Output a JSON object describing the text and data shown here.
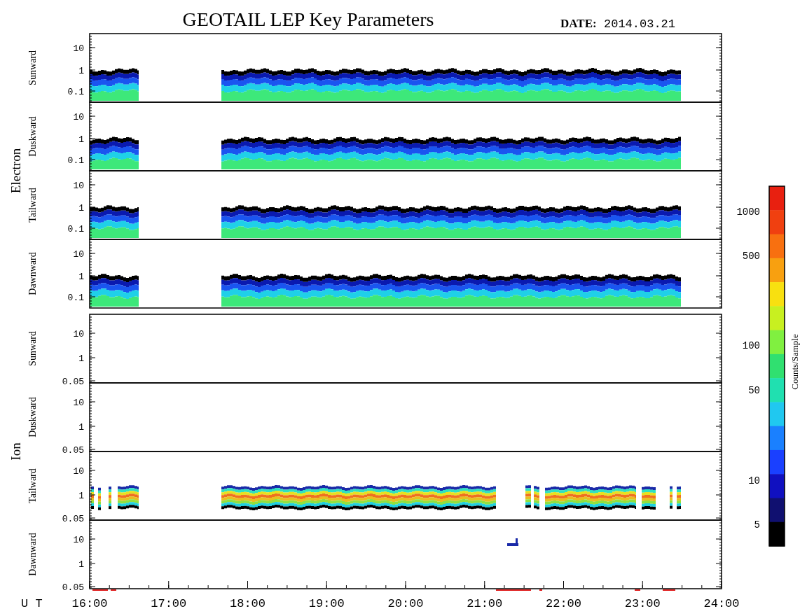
{
  "title": "GEOTAIL LEP Key Parameters",
  "date": {
    "label": "DATE:",
    "value": "2014.03.21"
  },
  "groups": [
    {
      "name": "Electron",
      "panels": [
        {
          "label": "Sunward",
          "kind": "electron",
          "yticks": [
            "10",
            "1",
            "0.1"
          ]
        },
        {
          "label": "Duskward",
          "kind": "electron",
          "yticks": [
            "10",
            "1",
            "0.1"
          ]
        },
        {
          "label": "Tailward",
          "kind": "electron",
          "yticks": [
            "10",
            "1",
            "0.1"
          ]
        },
        {
          "label": "Dawnward",
          "kind": "electron",
          "yticks": [
            "10",
            "1",
            "0.1"
          ]
        }
      ]
    },
    {
      "name": "Ion",
      "panels": [
        {
          "label": "Sunward",
          "kind": "empty",
          "yticks": [
            "10",
            "1",
            "0.05"
          ]
        },
        {
          "label": "Duskward",
          "kind": "empty",
          "yticks": [
            "10",
            "1",
            "0.05"
          ]
        },
        {
          "label": "Tailward",
          "kind": "ion-band",
          "yticks": [
            "10",
            "1",
            "0.05"
          ]
        },
        {
          "label": "Dawnward",
          "kind": "ion-speck",
          "yticks": [
            "10",
            "1",
            "0.05"
          ]
        }
      ]
    }
  ],
  "x_axis": {
    "label": "U T",
    "ticks": [
      "16:00",
      "17:00",
      "18:00",
      "19:00",
      "20:00",
      "21:00",
      "22:00",
      "23:00",
      "24:00"
    ]
  },
  "colorbar": {
    "title": "Counts/Sample",
    "ticks": [
      "1000",
      "500",
      "100",
      "50",
      "10",
      "5"
    ]
  }
}
